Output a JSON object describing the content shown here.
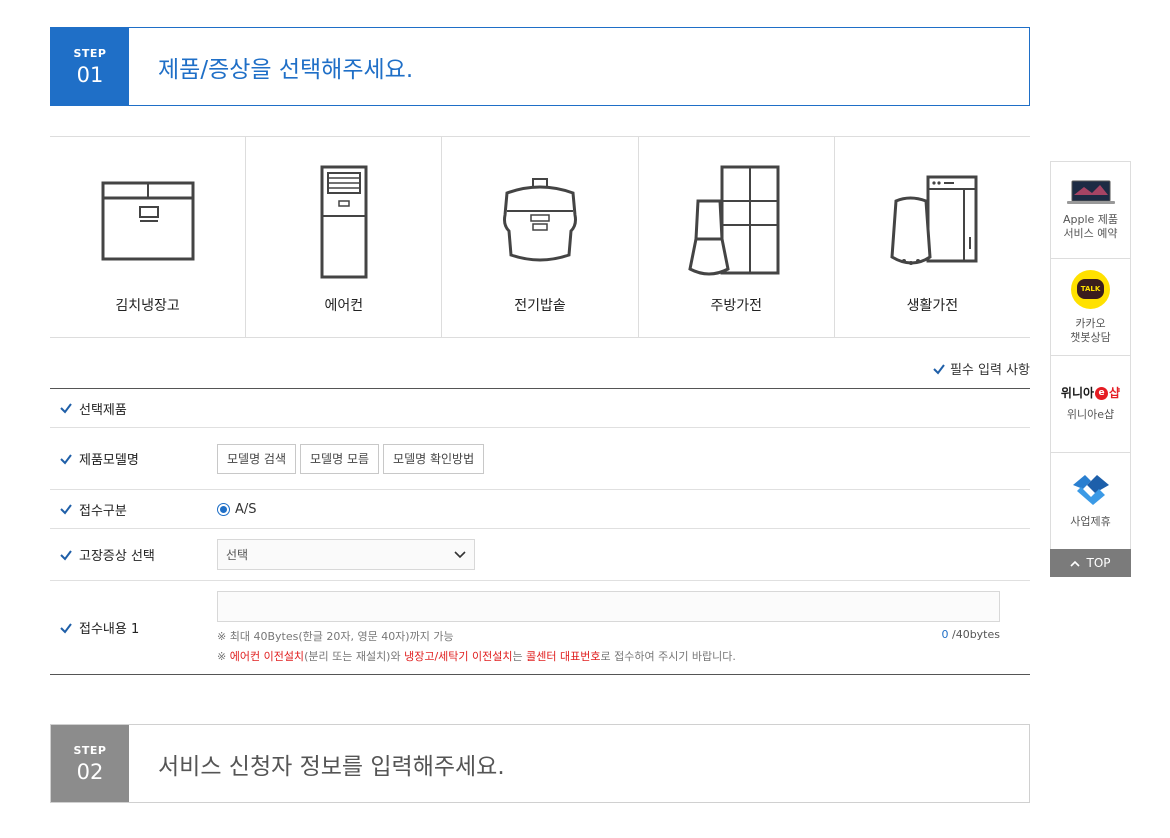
{
  "step1": {
    "label": "STEP",
    "number": "01",
    "title": "제품/증상을 선택해주세요."
  },
  "products": [
    {
      "name": "김치냉장고",
      "icon": "kimchi-fridge-icon"
    },
    {
      "name": "에어컨",
      "icon": "air-conditioner-icon"
    },
    {
      "name": "전기밥솥",
      "icon": "rice-cooker-icon"
    },
    {
      "name": "주방가전",
      "icon": "kitchen-appliance-icon"
    },
    {
      "name": "생활가전",
      "icon": "living-appliance-icon"
    }
  ],
  "required_note": "필수 입력 사항",
  "form": {
    "selected_product_label": "선택제품",
    "model_label": "제품모델명",
    "model_buttons": [
      "모델명 검색",
      "모델명 모름",
      "모델명 확인방법"
    ],
    "reception_label": "접수구분",
    "reception_option": "A/S",
    "symptom_label": "고장증상 선택",
    "symptom_value": "선택",
    "content_label": "접수내용 1",
    "content_value": "",
    "max_note": "※ 최대 40Bytes(한글 20자, 영문 40자)까지 가능",
    "byte_count": "0",
    "byte_max": "/40bytes",
    "notice": {
      "prefix": "※ ",
      "red1": "에어컨 이전설치",
      "mid1": "(분리 또는 재설치)와 ",
      "red2": "냉장고/세탁기 이전설치",
      "mid2": "는 ",
      "red3": "콜센터 대표번호",
      "suffix": "로 접수하여 주시기 바랍니다."
    }
  },
  "step2": {
    "label": "STEP",
    "number": "02",
    "title": "서비스 신청자 정보를 입력해주세요."
  },
  "quick_menu": {
    "apple": "Apple 제품\n서비스 예약",
    "apple_l1": "Apple 제품",
    "apple_l2": "서비스 예약",
    "kakao_badge": "TALK",
    "kakao_l1": "카카오",
    "kakao_l2": "챗봇상담",
    "winia_logo_a": "위니아",
    "winia_logo_e": "e",
    "winia_logo_b": "샵",
    "winia_label": "위니아e샵",
    "biz_label": "사업제휴",
    "top_label": "TOP"
  }
}
